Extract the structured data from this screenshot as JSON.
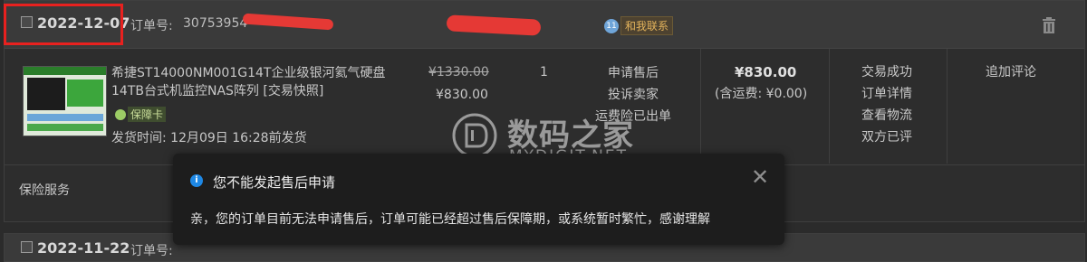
{
  "order1": {
    "date": "2022-12-07",
    "order_label": "订单号:",
    "order_number_visible": "30753954",
    "contact_label": "和我联系",
    "product": {
      "title_line1": "希捷ST14000NM001G14T企业级银河氦气硬盘",
      "title_line2": "14TB台式机监控NAS阵列 [交易快照]",
      "badge": "保障卡",
      "ship_time": "发货时间:  12月09日 16:28前发货",
      "original_price": "¥1330.00",
      "price": "¥830.00",
      "quantity": "1"
    },
    "aftersale": [
      "申请售后",
      "投诉卖家",
      "运费险已出单"
    ],
    "total": {
      "amount": "¥830.00",
      "shipping": "(含运费: ¥0.00)"
    },
    "status_links": [
      "交易成功",
      "订单详情",
      "查看物流",
      "双方已评"
    ],
    "review_link": "追加评论",
    "insurance": "保险服务"
  },
  "order2": {
    "date": "2022-11-22",
    "order_label": "订单号:"
  },
  "watermark": {
    "cn": "数码之家",
    "en": "MYDIGIT.NET"
  },
  "toast": {
    "title": "您不能发起售后申请",
    "message": "亲，您的订单目前无法申请售后，订单可能已经超过售后保障期，或系统暂时繁忙，感谢理解",
    "close": "✕"
  },
  "colors": {
    "highlight": "#e8211f",
    "redaction": "#e53935",
    "info": "#1e88e5"
  }
}
